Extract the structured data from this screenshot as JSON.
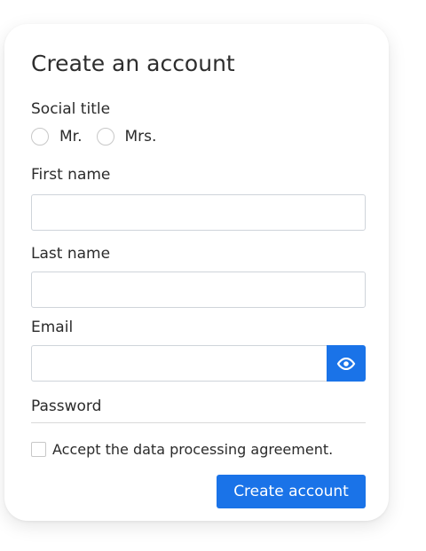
{
  "form": {
    "title": "Create an account",
    "social_title_label": "Social title",
    "social_title_options": [
      "Mr.",
      "Mrs."
    ],
    "first_name_label": "First name",
    "first_name_value": "",
    "last_name_label": "Last name",
    "last_name_value": "",
    "email_label": "Email",
    "email_value": "",
    "password_label": "Password",
    "agreement_label": "Accept the data processing agreement.",
    "submit_label": "Create account",
    "accent_color": "#1a73e8",
    "icons": {
      "reveal": "eye-icon"
    }
  }
}
